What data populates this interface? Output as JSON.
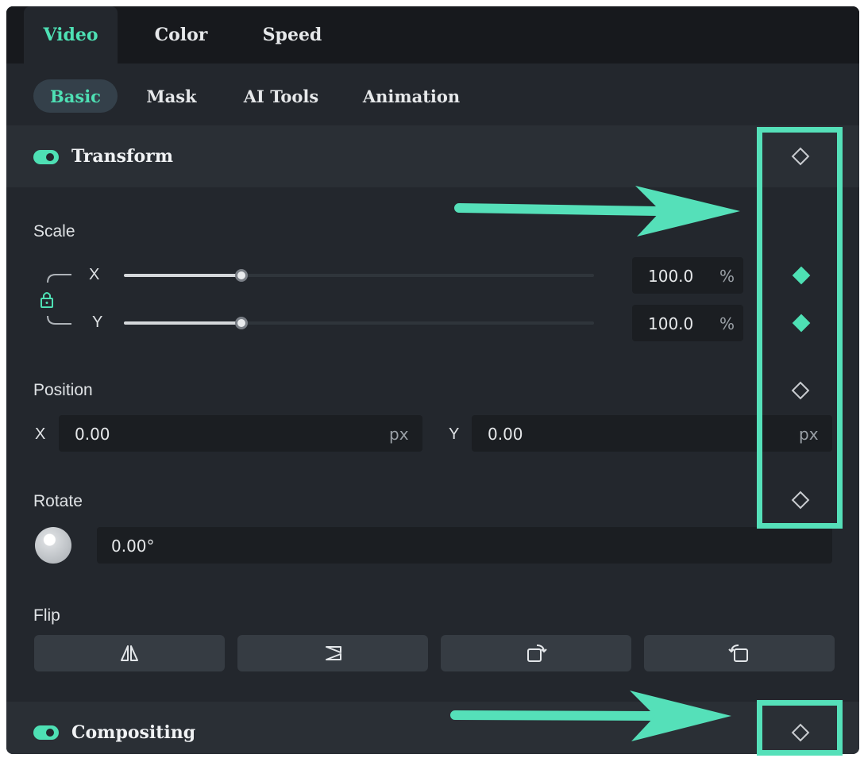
{
  "tabs": [
    {
      "label": "Video",
      "active": true
    },
    {
      "label": "Color",
      "active": false
    },
    {
      "label": "Speed",
      "active": false
    }
  ],
  "subtabs": [
    {
      "label": "Basic",
      "active": true
    },
    {
      "label": "Mask",
      "active": false
    },
    {
      "label": "AI Tools",
      "active": false
    },
    {
      "label": "Animation",
      "active": false
    }
  ],
  "transform": {
    "title": "Transform",
    "enabled": true,
    "scale": {
      "label": "Scale",
      "x_label": "X",
      "y_label": "Y",
      "x_value": "100.0",
      "y_value": "100.0",
      "unit": "%",
      "linked_icon": "lock-icon"
    },
    "position": {
      "label": "Position",
      "x_label": "X",
      "y_label": "Y",
      "x_value": "0.00",
      "y_value": "0.00",
      "unit": "px"
    },
    "rotate": {
      "label": "Rotate",
      "value": "0.00°"
    },
    "flip": {
      "label": "Flip",
      "buttons": [
        "flip-horizontal-icon",
        "flip-vertical-icon",
        "rotate-right-icon",
        "rotate-left-icon"
      ]
    }
  },
  "compositing": {
    "title": "Compositing",
    "enabled": true
  },
  "colors": {
    "accent": "#4ee0b4",
    "highlight": "#55e0b9",
    "panel_bg": "#23272d"
  }
}
